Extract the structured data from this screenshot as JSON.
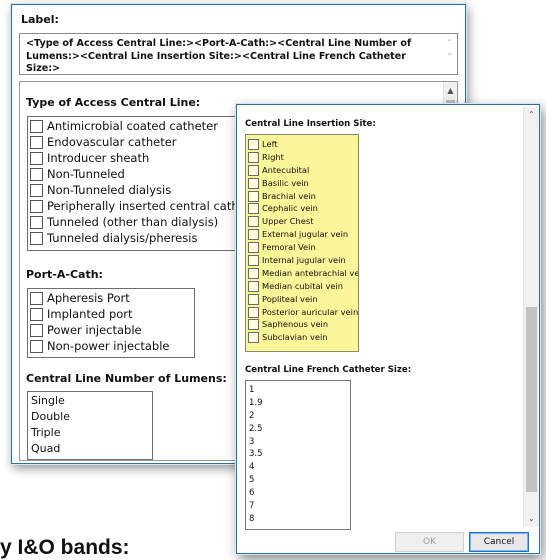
{
  "label_window": {
    "label_heading": "Label:",
    "label_value": "<Type of Access Central Line:><Port-A-Cath:><Central Line Number of Lumens:><Central Line Insertion Site:><Central Line French Catheter Size:>",
    "sections": {
      "access_type": {
        "heading": "Type of Access Central Line:",
        "options": [
          "Antimicrobial coated catheter",
          "Endovascular catheter",
          "Introducer sheath",
          "Non-Tunneled",
          "Non-Tunneled dialysis",
          "Peripherally inserted central catheter",
          "Tunneled (other than dialysis)",
          "Tunneled dialysis/pheresis"
        ]
      },
      "port_a_cath": {
        "heading": "Port-A-Cath:",
        "options": [
          "Apheresis Port",
          "Implanted port",
          "Power injectable",
          "Non-power injectable"
        ]
      },
      "lumens": {
        "heading": "Central Line Number of Lumens:",
        "options": [
          "Single",
          "Double",
          "Triple",
          "Quad"
        ]
      }
    }
  },
  "site_window": {
    "insertion_site": {
      "heading": "Central Line Insertion Site:",
      "options": [
        "Left",
        "Right",
        "Antecubital",
        "Basilic vein",
        "Brachial vein",
        "Cephalic vein",
        "Upper Chest",
        "External jugular vein",
        "Femoral Vein",
        "Internal jugular vein",
        "Median antebrachial vein",
        "Median cubital vein",
        "Popliteal vein",
        "Posterior auricular vein",
        "Saphenous vein",
        "Subclavian vein"
      ],
      "highlight_color": "#fbf59a"
    },
    "french_size": {
      "heading": "Central Line French Catheter Size:",
      "options": [
        "1",
        "1.9",
        "2",
        "2.5",
        "3",
        "3.5",
        "4",
        "5",
        "6",
        "7",
        "8"
      ]
    },
    "buttons": {
      "ok": "OK",
      "cancel": "Cancel"
    }
  },
  "background_text": "y I&O bands:",
  "colors": {
    "window_border": "#2f6f9f",
    "primary_button_border": "#1e72c8"
  }
}
